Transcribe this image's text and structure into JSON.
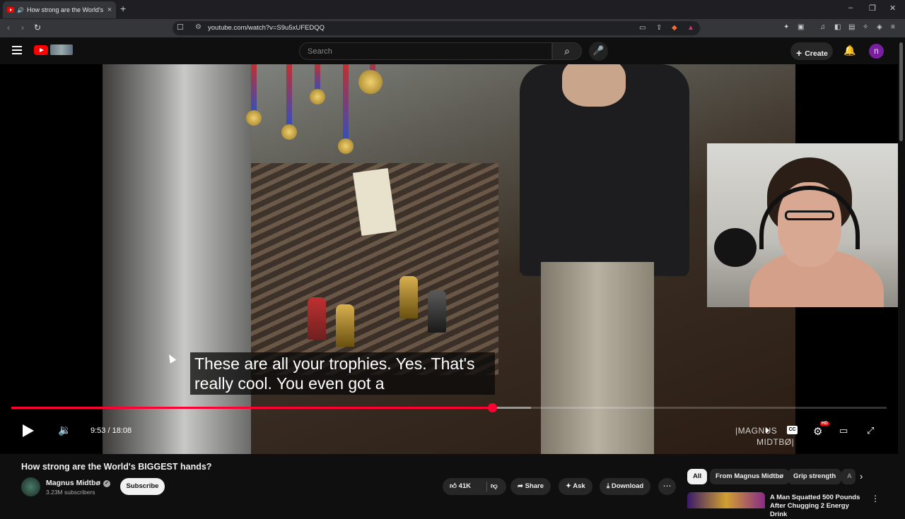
{
  "browser": {
    "tab_title": "How strong are the World's BIGGEST hands?",
    "new_tab": "+",
    "url": "youtube.com/watch?v=S9u5xUFEDQQ",
    "window_controls": [
      "–",
      "❐",
      "✕"
    ]
  },
  "header": {
    "search_placeholder": "Search",
    "create_label": "Create",
    "avatar_initial": "n"
  },
  "player": {
    "caption_line1": "These are all your trophies. Yes. That's",
    "caption_line2": "really cool. You even got a",
    "current_time": "9:53",
    "duration": "18:08",
    "time_display": "9:53 / 18:08",
    "progress_played": 0.549,
    "progress_buffered": 0.594,
    "watermark_line1": "|MAGNUS",
    "watermark_line2": "MIDTBØ|",
    "cc_label": "CC",
    "hd_badge": "HD",
    "colors": {
      "progress": "#ff0033"
    }
  },
  "video": {
    "title": "How strong are the World's BIGGEST hands?",
    "channel_name": "Magnus Midtbø",
    "subscribers": "3.23M subscribers",
    "subscribe_label": "Subscribe",
    "like_count": "41K",
    "share_label": "Share",
    "ask_label": "Ask",
    "download_label": "Download"
  },
  "sidebar": {
    "chips": [
      "All",
      "From Magnus Midtbø",
      "Grip strength",
      "A"
    ],
    "recommendation_title": "A Man Squatted 500 Pounds After Chugging 2 Energy Drink"
  },
  "icons": {
    "back": "back-arrow-icon",
    "forward": "forward-arrow-icon",
    "reload": "reload-icon",
    "search": "search-icon",
    "mic": "mic-icon",
    "bell": "bell-icon",
    "play": "play-icon",
    "volume": "volume-icon",
    "settings": "gear-icon",
    "fullscreen": "fullscreen-icon"
  }
}
